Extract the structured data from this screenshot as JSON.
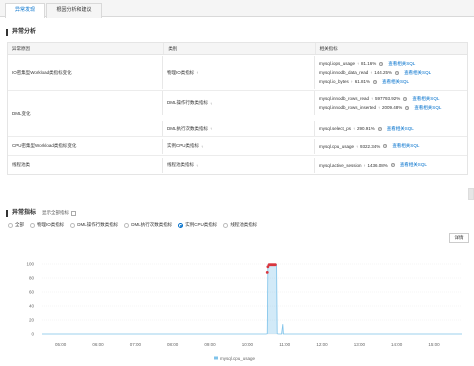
{
  "tabs": [
    {
      "label": "异常发现",
      "active": true
    },
    {
      "label": "根因分析和建议",
      "active": false
    }
  ],
  "anomaly_analysis": {
    "title": "异常分析",
    "headers": [
      "异常原因",
      "类别",
      "相关指标"
    ],
    "rows": [
      {
        "reason": "IO密集型Workload类指标变化",
        "groups": [
          {
            "category": "物理IO类指标",
            "metrics": [
              {
                "name": "mysql.iops_usage",
                "value": "81.16%"
              },
              {
                "name": "mysql.innodb_data_read",
                "value": "144.25%"
              },
              {
                "name": "mysql.io_bytes",
                "value": "61.81%"
              }
            ]
          }
        ]
      },
      {
        "reason": "DML变化",
        "groups": [
          {
            "category": "DML操作行数类指标",
            "metrics": [
              {
                "name": "mysql.innodb_rows_read",
                "value": "597793.92%"
              },
              {
                "name": "mysql.innodb_rows_inserted",
                "value": "2009.48%"
              }
            ]
          },
          {
            "category": "DML执行次数类指标",
            "metrics": [
              {
                "name": "mysql.select_ps",
                "value": "290.91%"
              }
            ]
          }
        ]
      },
      {
        "reason": "CPU密集型Workload类指标变化",
        "groups": [
          {
            "category": "实例CPU类指标",
            "metrics": [
              {
                "name": "mysql.cpu_usage",
                "value": "9322.34%"
              }
            ]
          }
        ]
      },
      {
        "reason": "线程池类",
        "groups": [
          {
            "category": "线程池类指标",
            "metrics": [
              {
                "name": "mysql.active_session",
                "value": "1436.08%"
              }
            ]
          }
        ]
      }
    ],
    "view_link": "查看相关SQL"
  },
  "anomaly_metrics": {
    "title": "异常指标",
    "show_all_label": "显示全部指标",
    "filters": [
      {
        "label": "全部",
        "checked": false
      },
      {
        "label": "物理IO类指标",
        "checked": false
      },
      {
        "label": "DML操作行数类指标",
        "checked": false
      },
      {
        "label": "DML执行次数类指标",
        "checked": false
      },
      {
        "label": "实例CPU类指标",
        "checked": true
      },
      {
        "label": "线程池类指标",
        "checked": false
      }
    ],
    "detail_button": "详情"
  },
  "colors": {
    "accent": "#0070cc",
    "series": "#7fc3ea",
    "anomaly": "#d9363e"
  },
  "chart_data": {
    "type": "line",
    "title": "",
    "xlabel": "",
    "ylabel": "",
    "x_ticks": [
      "05:00",
      "06:00",
      "07:00",
      "08:00",
      "09:00",
      "10:00",
      "11:00",
      "12:00",
      "13:00",
      "14:00",
      "15:00"
    ],
    "y_ticks": [
      0,
      20,
      40,
      60,
      80,
      100
    ],
    "ylim": [
      0,
      100
    ],
    "xlim": [
      "04:30",
      "15:45"
    ],
    "grid": true,
    "legend_position": "bottom",
    "series": [
      {
        "name": "mysql.cpu_usage",
        "points": [
          [
            "04:30",
            0
          ],
          [
            "10:30",
            0
          ],
          [
            "10:32",
            0.4
          ],
          [
            "10:33",
            99
          ],
          [
            "10:47",
            99
          ],
          [
            "10:48",
            0.4
          ],
          [
            "10:50",
            0
          ],
          [
            "10:55",
            0
          ],
          [
            "10:57",
            14
          ],
          [
            "10:58",
            0
          ],
          [
            "15:45",
            0
          ]
        ]
      }
    ],
    "anomaly_points": [
      [
        "10:32",
        88
      ],
      [
        "10:33",
        96
      ],
      [
        "10:35",
        99
      ],
      [
        "10:37",
        99
      ],
      [
        "10:39",
        99
      ],
      [
        "10:41",
        99
      ],
      [
        "10:43",
        99
      ],
      [
        "10:45",
        99
      ]
    ]
  }
}
